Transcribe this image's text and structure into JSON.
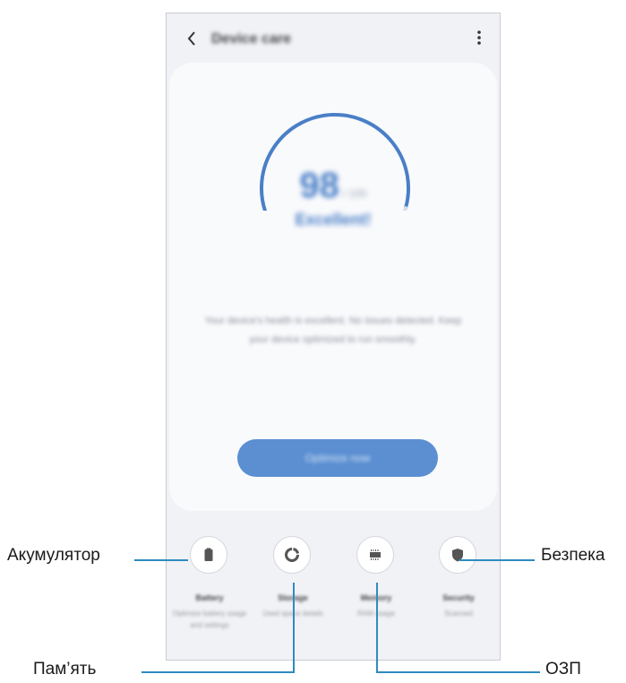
{
  "screen": {
    "title": "Device care",
    "back_icon": "back-arrow-icon",
    "more_icon": "more-vert-icon",
    "score_value": "98",
    "score_unit": "/ 100",
    "score_fraction": 0.98,
    "status": "Excellent!",
    "description": "Your device's health is excellent. No issues detected. Keep your device optimized to run smoothly.",
    "optimize_label": "Optimize now",
    "accent_color": "#4a7fc7",
    "features": [
      {
        "title": "Battery",
        "subtitle": "Optimize battery usage and settings",
        "icon": "battery-icon"
      },
      {
        "title": "Storage",
        "subtitle": "Used space details",
        "icon": "storage-pie-icon"
      },
      {
        "title": "Memory",
        "subtitle": "RAM usage",
        "icon": "memory-chip-icon"
      },
      {
        "title": "Security",
        "subtitle": "Scanned",
        "icon": "shield-icon"
      }
    ]
  },
  "callouts": {
    "battery": "Акумулятор",
    "security": "Безпека",
    "storage": "Пам’ять",
    "memory": "ОЗП"
  },
  "callout_line_color": "#2e8bc0"
}
